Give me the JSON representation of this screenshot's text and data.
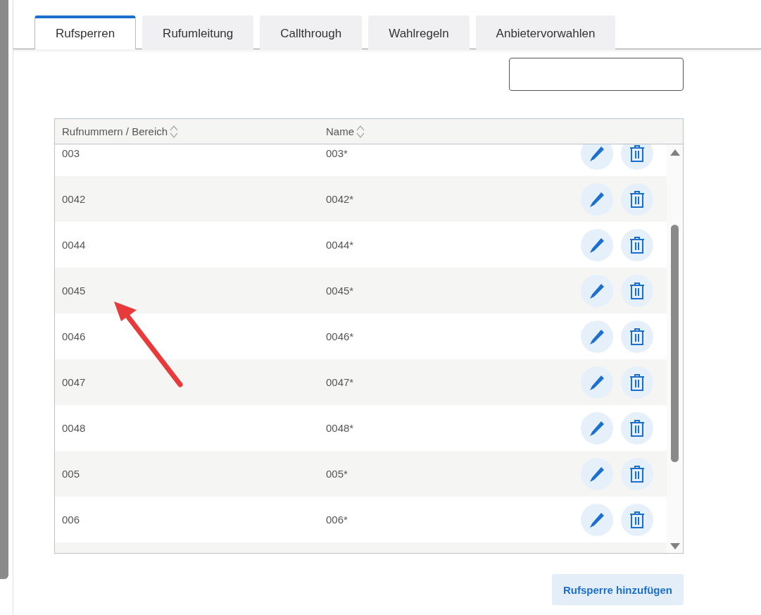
{
  "tabs": [
    {
      "label": "Rufsperren",
      "selected": true
    },
    {
      "label": "Rufumleitung",
      "selected": false
    },
    {
      "label": "Callthrough",
      "selected": false
    },
    {
      "label": "Wahlregeln",
      "selected": false
    },
    {
      "label": "Anbietervorwahlen",
      "selected": false
    }
  ],
  "table": {
    "columns": [
      "Rufnummern / Bereich",
      "Name"
    ],
    "rows": [
      {
        "number": "003",
        "name": "003*"
      },
      {
        "number": "0042",
        "name": "0042*"
      },
      {
        "number": "0044",
        "name": "0044*"
      },
      {
        "number": "0045",
        "name": "0045*"
      },
      {
        "number": "0046",
        "name": "0046*"
      },
      {
        "number": "0047",
        "name": "0047*"
      },
      {
        "number": "0048",
        "name": "0048*"
      },
      {
        "number": "005",
        "name": "005*"
      },
      {
        "number": "006",
        "name": "006*"
      }
    ]
  },
  "add_button": "Rufsperre hinzufügen"
}
